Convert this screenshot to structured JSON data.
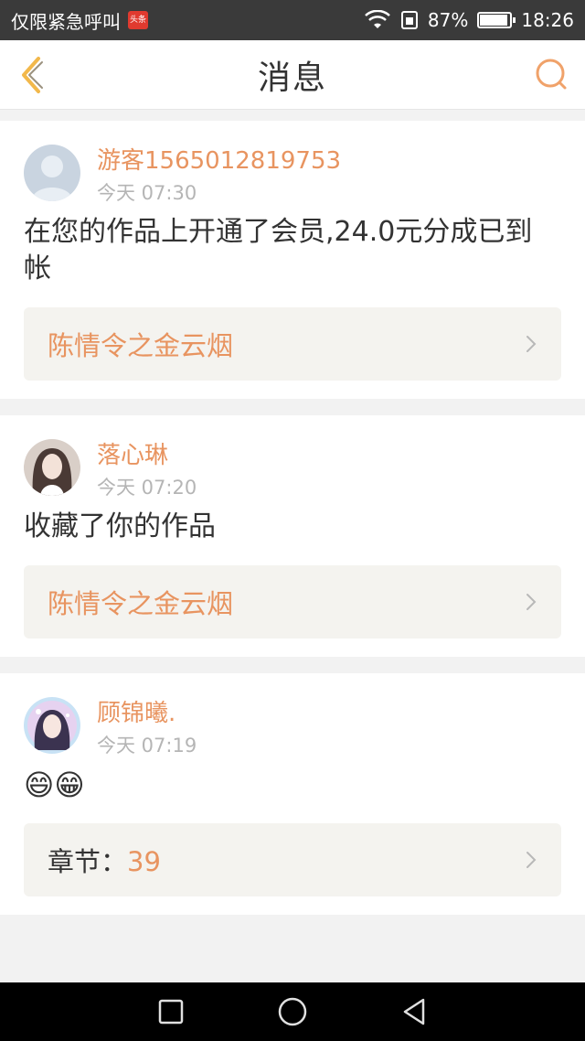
{
  "status_bar": {
    "carrier": "仅限紧急呼叫",
    "news_badge": "头条",
    "battery": "87%",
    "battery_level": 0.87,
    "time": "18:26"
  },
  "header": {
    "title": "消息",
    "back_icon": "chevron-left-icon",
    "search_icon": "search-icon",
    "accent_color": "#e89460"
  },
  "messages": [
    {
      "username": "游客1565012819753",
      "time": "今天 07:30",
      "text": "在您的作品上开通了会员,24.0元分成已到帐",
      "link_label": "",
      "link_value": "陈情令之金云烟"
    },
    {
      "username": "落心琳",
      "time": "今天 07:20",
      "text": "收藏了你的作品",
      "link_label": "",
      "link_value": "陈情令之金云烟"
    },
    {
      "username": "顾锦曦.",
      "time": "今天 07:19",
      "text": "😄😁",
      "link_label": "章节：",
      "link_value": "39"
    }
  ],
  "nav": {
    "recent": "recent-apps-icon",
    "home": "home-icon",
    "back": "back-triangle-icon"
  }
}
